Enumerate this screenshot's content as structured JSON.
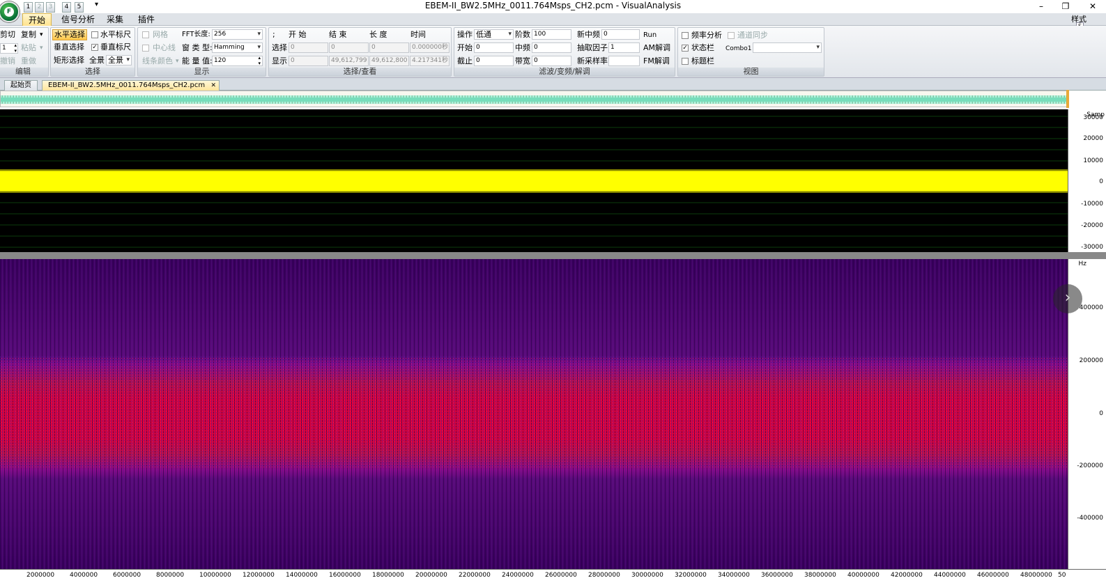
{
  "window": {
    "title": "EBEM-II_BW2.5MHz_0011.764Msps_CH2.pcm - VisualAnalysis",
    "orb_letter": "F",
    "quick_access": [
      "1",
      "2",
      "3",
      "4",
      "5"
    ],
    "controls": {
      "minimize": "–",
      "restore": "❐",
      "close": "✕"
    }
  },
  "menu": {
    "tabs": [
      "开始",
      "信号分析",
      "采集",
      "插件"
    ],
    "active_tab": "开始",
    "style_label": "样式"
  },
  "ribbon": {
    "edit": {
      "label": "编辑",
      "cut": "剪切",
      "copy": "复制",
      "spinner_value": "1",
      "paste": "粘贴",
      "undo": "撤销",
      "redo": "重做"
    },
    "select": {
      "label": "选择",
      "h_select": "水平选择",
      "v_select": "垂直选择",
      "rect_select": "矩形选择",
      "h_ruler": "水平标尺",
      "v_ruler": "垂直标尺",
      "full_label": "全景",
      "full_value": "全景",
      "h_ruler_checked": false,
      "v_ruler_checked": true
    },
    "display": {
      "label": "显示",
      "grid": "网格",
      "center_line": "中心线",
      "line_color": "线条颜色",
      "fft_label": "FFT长度:",
      "fft_value": "256",
      "window_label": "窗 类 型:",
      "window_value": "Hamming",
      "energy_label": "能 量 值:",
      "energy_value": "120"
    },
    "select_view": {
      "label": "选择/查看",
      "headers": [
        ";",
        "开  始",
        "结  束",
        "长  度",
        "时间"
      ],
      "rows": [
        {
          "label": "选择",
          "values": [
            "0",
            "0",
            "0",
            "0.000000秒"
          ]
        },
        {
          "label": "显示",
          "values": [
            "0",
            "49,612,799",
            "49,612,800",
            "4.217341秒"
          ]
        }
      ]
    },
    "filter": {
      "label": "滤波/变频/解调",
      "op_label": "操作",
      "op_value": "低通",
      "start_label": "开始",
      "start_value": "0",
      "cut_label": "截止",
      "cut_value": "0",
      "order_label": "阶数",
      "order_value": "100",
      "cf_label": "中频",
      "cf_value": "0",
      "bw_label": "带宽",
      "bw_value": "0",
      "new_cf_label": "新中频",
      "new_cf_value": "0",
      "decim_label": "抽取因子",
      "decim_value": "1",
      "new_sr_label": "新采样率",
      "new_sr_value": "",
      "run": "Run",
      "am": "AM解调",
      "fm": "FM解调"
    },
    "view": {
      "label": "视图",
      "freq_analysis": "频率分析",
      "channel_sync": "通道同步",
      "status_bar": "状态栏",
      "title_bar": "标题栏",
      "combo_label": "Combo1",
      "combo_value": "",
      "status_bar_checked": true
    }
  },
  "doc_tabs": {
    "home": "起始页",
    "file": "EBEM-II_BW2.5MHz_0011.764Msps_CH2.pcm",
    "close": "✕"
  },
  "time_plot": {
    "unit": "Samp",
    "y_ticks": [
      "30000",
      "20000",
      "10000",
      "0",
      "-10000",
      "-20000",
      "-30000"
    ],
    "colors": {
      "background": "#000000",
      "signal": "#ffff00",
      "grid": "#0b3d0b"
    }
  },
  "spectrogram": {
    "unit": "Hz",
    "y_ticks": [
      "400000",
      "200000",
      "0",
      "-200000",
      "-400000"
    ],
    "colors": {
      "background": "#3a005e",
      "band": "#e0003a",
      "edge": "#8a0a8a"
    }
  },
  "x_axis": {
    "ticks": [
      "2000000",
      "4000000",
      "6000000",
      "8000000",
      "10000000",
      "12000000",
      "14000000",
      "16000000",
      "18000000",
      "20000000",
      "22000000",
      "24000000",
      "26000000",
      "28000000",
      "30000000",
      "32000000",
      "34000000",
      "36000000",
      "38000000",
      "40000000",
      "42000000",
      "44000000",
      "46000000",
      "48000000"
    ],
    "last_tick": "50"
  },
  "nav": {
    "next_icon": "›"
  }
}
